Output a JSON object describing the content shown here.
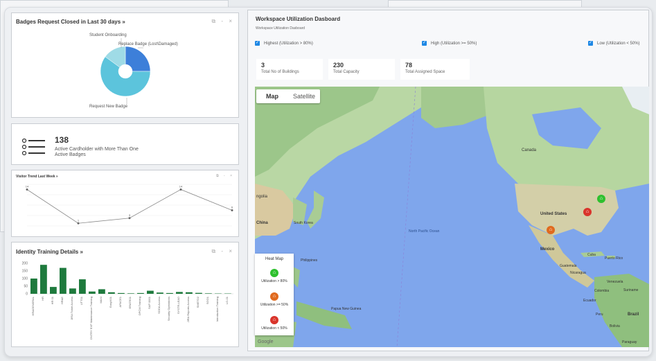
{
  "badges_widget": {
    "title": "Badges Request Closed in Last 30 days »",
    "controls": "⧉ - ×",
    "labels": [
      "Student Onboarding",
      "Replace Badge (Lost\\Damaged)",
      "Request New Badge"
    ],
    "colors": [
      "#3d7fd9",
      "#5cc4dc",
      "#9fdbe6"
    ]
  },
  "cardholder_widget": {
    "icon": "list-icon",
    "value": "138",
    "label": "Active Cardholder with More Than One Active Badges"
  },
  "visitor_widget": {
    "title": "Visitor Trend Last Week »",
    "controls": "⧉ - ×"
  },
  "training_widget": {
    "title": "Identity Training Details »",
    "controls": "⧉ - ×",
    "ytick_labels": [
      "200",
      "150",
      "100",
      "50",
      "0"
    ]
  },
  "workspace": {
    "title": "Workspace Utilization Dasboard",
    "subtitle": "Workspace Utilization Dasboard",
    "filters": [
      "Highest (Utilization > 80%)",
      "High (Utilization >= 50%)",
      "Low (Utilization < 50%)"
    ],
    "kpis": [
      {
        "value": "3",
        "label": "Total No of Buildings"
      },
      {
        "value": "230",
        "label": "Total Capacity"
      },
      {
        "value": "78",
        "label": "Total Assigned Space"
      }
    ],
    "map_tabs": [
      "Map",
      "Satellite"
    ],
    "map_labels": {
      "canada": "Canada",
      "usa": "United States",
      "mexico": "Mexico",
      "china": "China",
      "south_korea": "South Korea",
      "mongolia": "ngolia",
      "pacific": "North Pacific Ocean",
      "cuba": "Cuba",
      "puerto_rico": "Puerto Rico",
      "guatemala": "Guatemala",
      "nicaragua": "Nicaragua",
      "venezuela": "Venezuela",
      "colombia": "Colombia",
      "suriname": "Suriname",
      "ecuador": "Ecuador",
      "peru": "Peru",
      "brazil": "Brazil",
      "bolivia": "Bolivia",
      "paraguay": "Paraguay",
      "philippines": "Philippines",
      "papua": "Papua New Guinea",
      "google": "Google"
    },
    "legend": {
      "title": "Heat Map",
      "items": [
        {
          "label": "Utilization > 80%",
          "color": "#2ec02e"
        },
        {
          "label": "Utilization >= 50%",
          "color": "#e06a1e"
        },
        {
          "label": "Utilization < 50%",
          "color": "#d9342b"
        }
      ]
    }
  },
  "chart_data": [
    {
      "type": "pie",
      "title": "Badges Request Closed in Last 30 days",
      "categories": [
        "Replace Badge (Lost\\Damaged)",
        "Request New Badge",
        "Student Onboarding"
      ],
      "values": [
        25,
        60,
        15
      ]
    },
    {
      "type": "line",
      "title": "Visitor Trend Last Week",
      "categories": [
        "",
        "",
        "",
        "",
        ""
      ],
      "values": [
        14,
        1,
        3,
        14,
        6
      ],
      "data_labels": [
        "14",
        "1",
        "3",
        "14",
        "6"
      ],
      "ylim": [
        0,
        16
      ]
    },
    {
      "type": "bar",
      "title": "Identity Training Details",
      "categories": [
        "HR&GENERAL",
        "HR",
        "HR 01",
        "HR&E",
        "JIRA Ticket Access",
        "UTT01",
        "DNTRY EXP Maintenance Training",
        "MAXI",
        "EasyX01",
        "APACE1",
        "ERATE01",
        "DPCM Training",
        "SAP 0001",
        "SODA Access",
        "Security Operations",
        "SYSTR-LEAD",
        "JIRA Reports Access",
        "SMETO2",
        "SGO1",
        "Introduction Training",
        "LG-01"
      ],
      "values": [
        100,
        190,
        45,
        170,
        35,
        95,
        15,
        30,
        10,
        5,
        3,
        5,
        20,
        8,
        5,
        12,
        10,
        6,
        3,
        2,
        2
      ],
      "ylim": [
        0,
        200
      ]
    }
  ]
}
